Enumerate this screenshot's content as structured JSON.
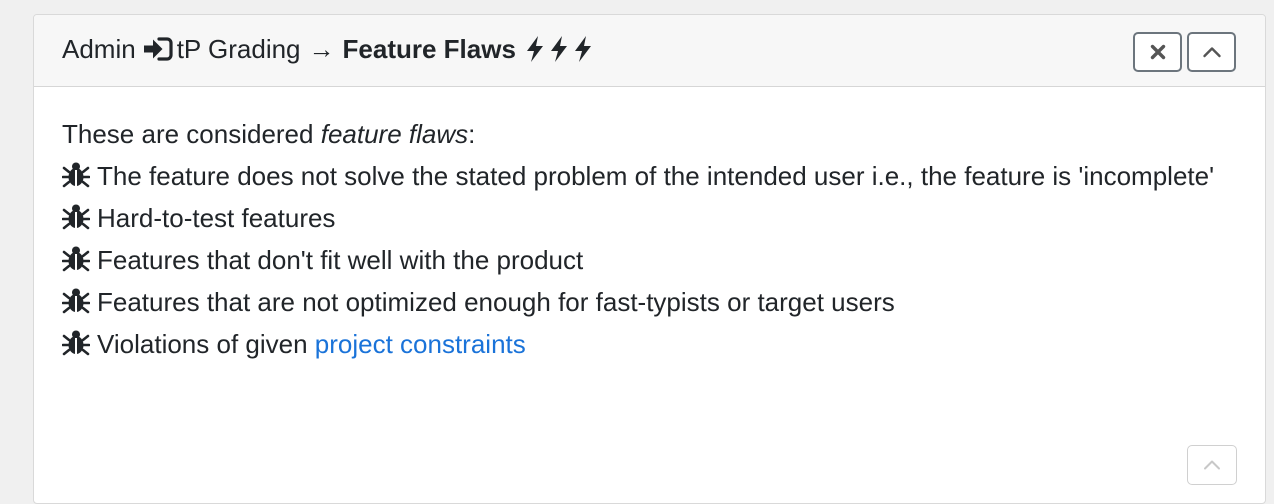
{
  "header": {
    "crumb_1": "Admin",
    "crumb_1_icon": "sign-in-icon",
    "crumb_2": "tP Grading",
    "separator": "→",
    "current": "Feature Flaws",
    "bolt_icon": "bolt-icon",
    "close_icon": "close-icon",
    "collapse_icon": "chevron-up-icon"
  },
  "body": {
    "intro_prefix": "These are considered ",
    "intro_em": "feature flaws",
    "intro_suffix": ":",
    "bullet_icon": "bug-icon",
    "items": [
      "The feature does not solve the stated problem of the intended user i.e., the feature is 'incomplete'",
      "Hard-to-test features",
      "Features that don't fit well with the product",
      "Features that are not optimized enough for fast-typists or target users"
    ],
    "last_item_prefix": "Violations of given ",
    "last_item_link": "project constraints"
  },
  "footer": {
    "scroll_top_icon": "chevron-up-icon"
  },
  "colors": {
    "link": "#1a73d9",
    "header_bg": "#f7f7f7",
    "button_border": "#6c757d"
  }
}
